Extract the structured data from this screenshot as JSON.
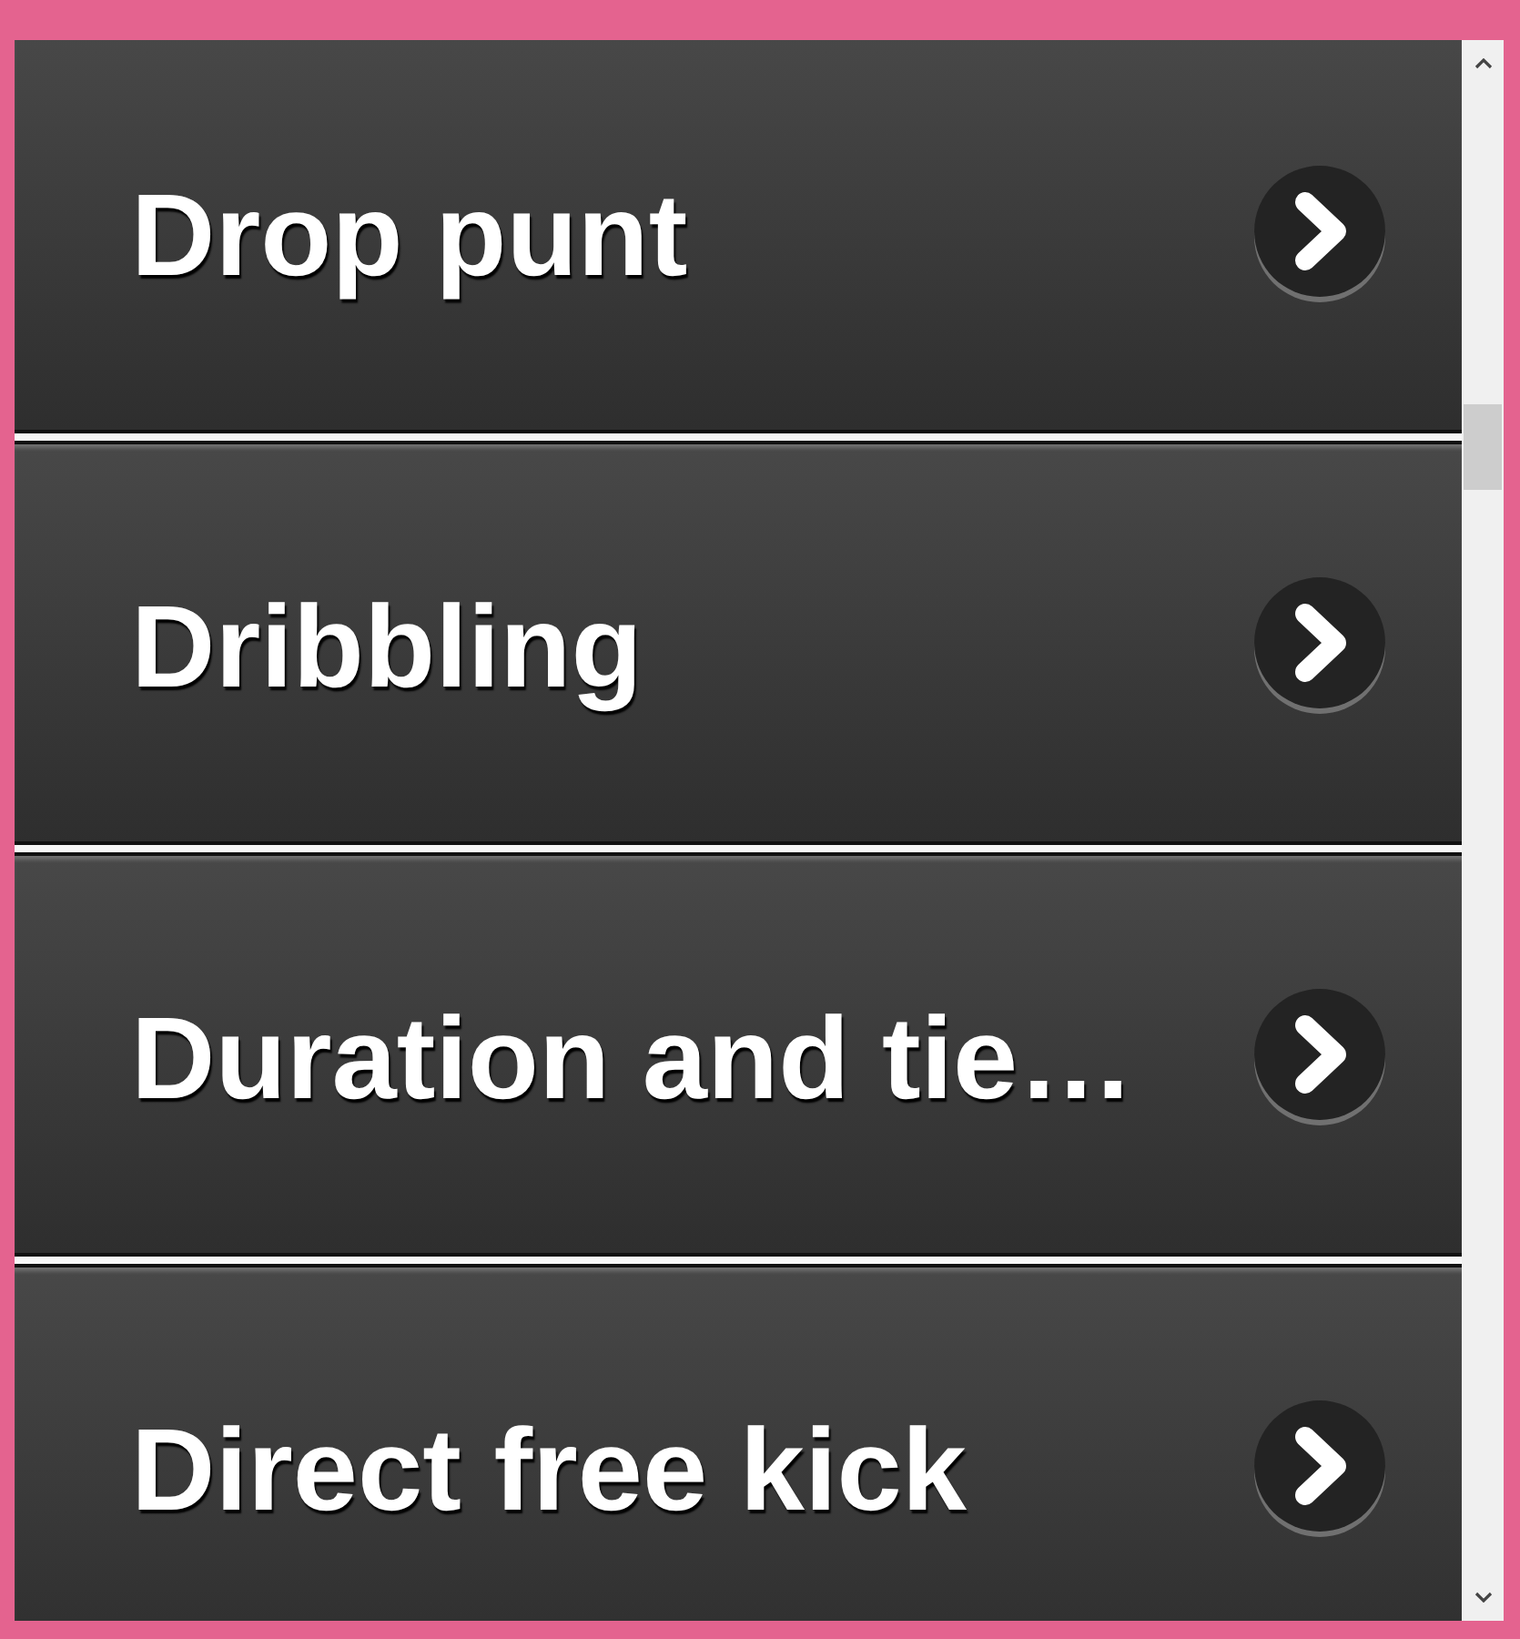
{
  "list": {
    "items": [
      {
        "label": "Drop punt"
      },
      {
        "label": "Dribbling"
      },
      {
        "label": "Duration and tie…"
      },
      {
        "label": "Direct free kick"
      }
    ]
  }
}
